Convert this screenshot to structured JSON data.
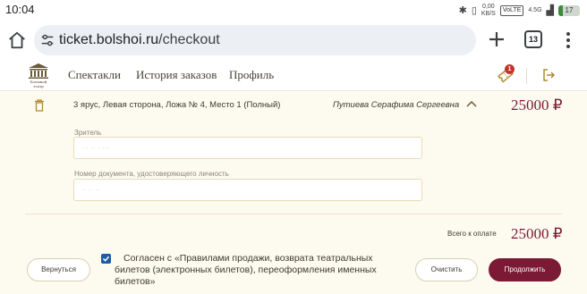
{
  "status_bar": {
    "time": "10:04",
    "data_speed": "0,00",
    "data_unit": "KB/S",
    "volte": "VoLTE",
    "network": "4.5G",
    "battery": "17"
  },
  "browser": {
    "url_host": "ticket.bolshoi.ru",
    "url_path": "/checkout",
    "tab_count": "13"
  },
  "site_nav": {
    "logo_caption_1": "Большой",
    "logo_caption_2": "театр",
    "links": [
      "Спектакли",
      "История заказов",
      "Профиль"
    ],
    "cart_badge": "1"
  },
  "ticket": {
    "seat": "3 ярус, Левая сторона, Ложа № 4, Место 1 (Полный)",
    "holder": "Путиева Серафима Сергеевна",
    "price": "25000 ₽"
  },
  "form": {
    "viewer_label": "Зритель",
    "viewer_value": "··· ·· ·····",
    "document_label": "Номер документа, удостоверяющего личность",
    "document_value": "·· ·· ··"
  },
  "summary": {
    "total_label": "Всего к оплате",
    "total_value": "25000 ₽"
  },
  "consent": {
    "checked": true,
    "text": "Согласен с «Правилами продажи, возврата театральных билетов (электронных билетов), переоформления именных билетов»"
  },
  "buttons": {
    "back": "Вернуться",
    "clear": "Очистить",
    "proceed": "Продолжить"
  },
  "colors": {
    "brand": "#7b1a35",
    "background": "#fdfaef",
    "checkbox": "#1f5ba6"
  }
}
